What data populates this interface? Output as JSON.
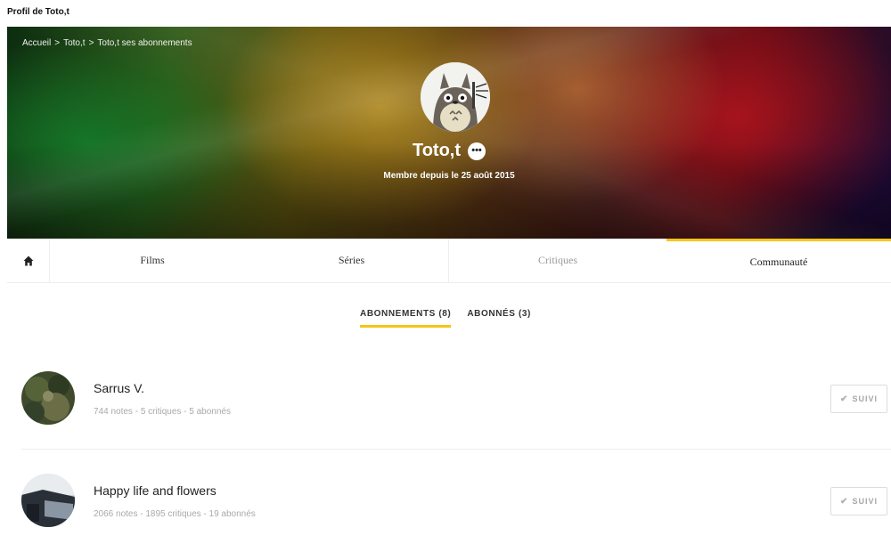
{
  "window_title": "Profil de Toto,t",
  "breadcrumb": {
    "items": [
      "Accueil",
      "Toto,t",
      "Toto,t ses abonnements"
    ],
    "separator": ">"
  },
  "profile": {
    "username": "Toto,t",
    "more_label": "•••",
    "member_since": "Membre depuis le 25 août 2015"
  },
  "nav": {
    "home_icon": "home-icon",
    "tabs": [
      "Films",
      "Séries",
      "Critiques",
      "Communauté"
    ],
    "active": "Communauté"
  },
  "subtabs": {
    "items": [
      "ABONNEMENTS (8)",
      "ABONNÉS (3)"
    ],
    "active": "ABONNEMENTS (8)"
  },
  "follows": [
    {
      "name": "Sarrus V.",
      "stats": "744 notes - 5 critiques - 5 abonnés",
      "button_label": "SUIVI",
      "button_icon": "check-icon"
    },
    {
      "name": "Happy life and flowers",
      "stats": "2066 notes - 1895 critiques - 19 abonnés",
      "button_label": "SUIVI",
      "button_icon": "check-icon"
    }
  ],
  "colors": {
    "accent": "#f5c518",
    "muted_text": "#a9a9a9"
  }
}
